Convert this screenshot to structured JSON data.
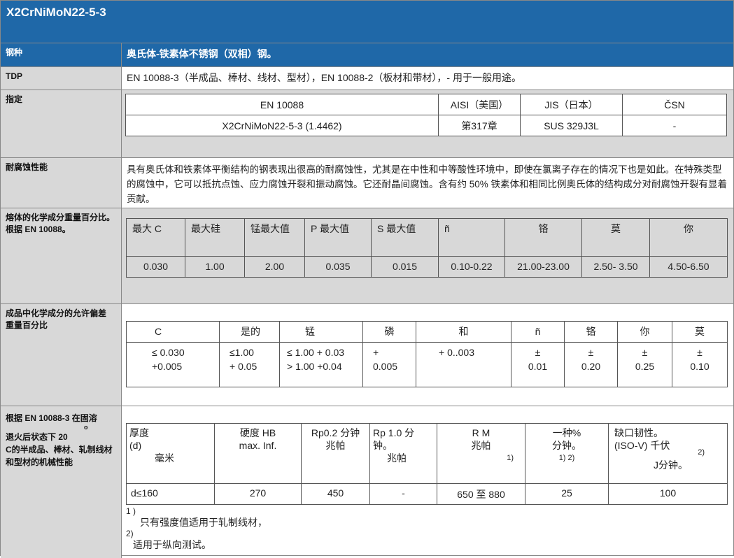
{
  "title": "X2CrNiMoN22-5-3",
  "rows": {
    "grade": {
      "label": "钢种",
      "value": "奥氏体-铁素体不锈钢（双相）钢。"
    },
    "tdp": {
      "label": "TDP",
      "value": "EN 10088-3（半成品、棒材、线材、型材），EN 10088-2（板材和带材），- 用于一般用途。"
    },
    "designation": {
      "label": "指定",
      "headers": [
        "EN 10088",
        "AISI（美国）",
        "JIS（日本）",
        "ČSN"
      ],
      "values": [
        "X2CrNiMoN22-5-3 (1.4462)",
        "第317章",
        "SUS 329J3L",
        "-"
      ]
    },
    "corrosion": {
      "label": "耐腐蚀性能",
      "value": "具有奥氏体和铁素体平衡结构的钢表现出很高的耐腐蚀性，尤其是在中性和中等酸性环境中，即使在氯离子存在的情况下也是如此。在特殊类型的腐蚀中，它可以抵抗点蚀、应力腐蚀开裂和振动腐蚀。它还耐晶间腐蚀。含有约 50% 铁素体和相同比例奥氏体的结构成分对耐腐蚀开裂有显着贡献。"
    },
    "melt": {
      "label": "熔体的化学成分重量百分比。根据 EN 10088。",
      "headers": [
        "最大 C",
        "最大硅",
        "锰最大值",
        "P 最大值",
        "S 最大值",
        "ñ",
        "铬",
        "莫",
        "你"
      ],
      "values": [
        "0.030",
        "1.00",
        "2.00",
        "0.035",
        "0.015",
        "0.10-0.22",
        "21.00-23.00",
        "2.50- 3.50",
        "4.50-6.50"
      ]
    },
    "tolerance": {
      "label": "成品中化学成分的允许偏差\n重量百分比",
      "headers": [
        "C",
        "是的",
        "锰",
        "磷",
        "和",
        "ñ",
        "铬",
        "你",
        "莫"
      ],
      "values": [
        "≤ 0.030\n+0.005",
        "≤1.00\n+ 0.05",
        "≤ 1.00 + 0.03\n> 1.00 +0.04",
        "+\n0.005",
        "+ 0..003",
        "±\n0.01",
        "±\n0.20",
        "±\n0.25",
        "±\n0.10"
      ]
    },
    "mechanical": {
      "label_a": "根据 EN 10088-3 在固溶",
      "label_sup": "o",
      "label_b": "退火后状态下 20",
      "label_c": "C的半成品、棒材、轧制线材和型材的机械性能",
      "headers": {
        "thickness": "厚度\n(d)",
        "thickness_unit": "毫米",
        "hb": "硬度 HB\nmax. Inf.",
        "rp02": "Rp0.2 分钟\n兆帕",
        "rp10": "Rp 1.0 分钟。",
        "rp10_unit": "兆帕",
        "rm": "R M\n兆帕",
        "rm_note": "1)",
        "a": "一种%\n分钟。",
        "a_note": "1) 2)",
        "kv": "缺口韧性。\n(ISO-V) 千伏",
        "kv_note": "2)",
        "kv_unit": "J分钟。"
      },
      "values": [
        "d≤160",
        "270",
        "450",
        "-",
        "650 至 880",
        "25",
        "100"
      ],
      "notes": [
        {
          "mark": "1 )",
          "text": "只有强度值适用于轧制线材，"
        },
        {
          "mark": "2)",
          "text": "适用于纵向测试。"
        }
      ]
    }
  }
}
